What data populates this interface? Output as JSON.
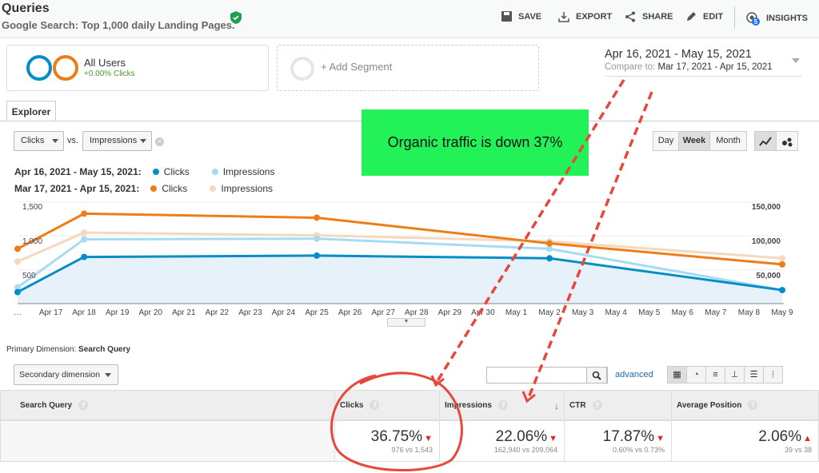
{
  "header": {
    "title": "Queries",
    "subtitle": "Google Search: Top 1,000 daily Landing Pages.",
    "actions": [
      {
        "label": "SAVE",
        "icon": "save-icon"
      },
      {
        "label": "EXPORT",
        "icon": "export-icon"
      },
      {
        "label": "SHARE",
        "icon": "share-icon"
      },
      {
        "label": "EDIT",
        "icon": "pencil-icon"
      },
      {
        "label": "INSIGHTS",
        "icon": "insights-icon",
        "badge": "5"
      }
    ]
  },
  "segments": {
    "name": "All Users",
    "metric": "+0.00% Clicks",
    "add": "+ Add Segment"
  },
  "date_range": {
    "primary": "Apr 16, 2021 - May 15, 2021",
    "compare_label": "Compare to:",
    "compare": "Mar 17, 2021 - Apr 15, 2021"
  },
  "tab": "Explorer",
  "controls": {
    "metric1": "Clicks",
    "vs": "vs.",
    "metric2": "Impressions",
    "granularity": [
      "Day",
      "Week",
      "Month"
    ],
    "selected": "Week"
  },
  "legend": [
    {
      "period": "Apr 16, 2021 - May 15, 2021:",
      "items": [
        "Clicks",
        "Impressions"
      ]
    },
    {
      "period": "Mar 17, 2021 - Apr 15, 2021:",
      "items": [
        "Clicks",
        "Impressions"
      ]
    }
  ],
  "annotation": "Organic traffic is down 37%",
  "colors": {
    "clicks_current": "#058dc7",
    "impressions_current": "#a6dcf2",
    "clicks_previous": "#ed7e17",
    "impressions_previous": "#f4d8bf",
    "annotation_bg": "#22f257",
    "annotation_red": "#e8473b"
  },
  "chart_data": {
    "type": "line",
    "x_tick_labels": [
      "…",
      "Apr 17",
      "Apr 18",
      "Apr 19",
      "Apr 20",
      "Apr 21",
      "Apr 22",
      "Apr 23",
      "Apr 24",
      "Apr 25",
      "Apr 26",
      "Apr 27",
      "Apr 28",
      "Apr 29",
      "Apr 30",
      "May 1",
      "May 2",
      "May 3",
      "May 4",
      "May 5",
      "May 6",
      "May 7",
      "May 8",
      "May 9"
    ],
    "x": [
      "Apr 16",
      "Apr 18",
      "Apr 25",
      "May 2",
      "May 9"
    ],
    "left_axis": {
      "ticks": [
        "500",
        "1,000",
        "1,500"
      ],
      "range": [
        0,
        1500
      ]
    },
    "right_axis": {
      "ticks": [
        "50,000",
        "100,000",
        "150,000"
      ],
      "range": [
        0,
        150000
      ]
    },
    "series": [
      {
        "name": "Clicks",
        "period": "current",
        "axis": "left",
        "values": [
          170,
          690,
          710,
          670,
          200
        ]
      },
      {
        "name": "Impressions",
        "period": "current",
        "axis": "right",
        "values": [
          24000,
          95000,
          96000,
          81000,
          20000
        ]
      },
      {
        "name": "Clicks",
        "period": "previous",
        "axis": "left",
        "values": [
          810,
          1330,
          1270,
          890,
          580
        ]
      },
      {
        "name": "Impressions",
        "period": "previous",
        "axis": "right",
        "values": [
          62000,
          105000,
          101000,
          92000,
          67000
        ]
      }
    ]
  },
  "table": {
    "primary_dimension_label": "Primary Dimension:",
    "primary_dimension": "Search Query",
    "secondary": "Secondary dimension",
    "advanced": "advanced",
    "columns": [
      "Search Query",
      "Clicks",
      "Impressions",
      "CTR",
      "Average Position"
    ],
    "totals": [
      {
        "value": "36.75%",
        "direction": "down",
        "detail": "976 vs 1,543"
      },
      {
        "value": "22.06%",
        "direction": "down",
        "detail": "162,940 vs 209,064"
      },
      {
        "value": "17.87%",
        "direction": "down",
        "detail": "0.60% vs 0.73%"
      },
      {
        "value": "2.06%",
        "direction": "up",
        "detail": "39 vs 38"
      }
    ]
  }
}
